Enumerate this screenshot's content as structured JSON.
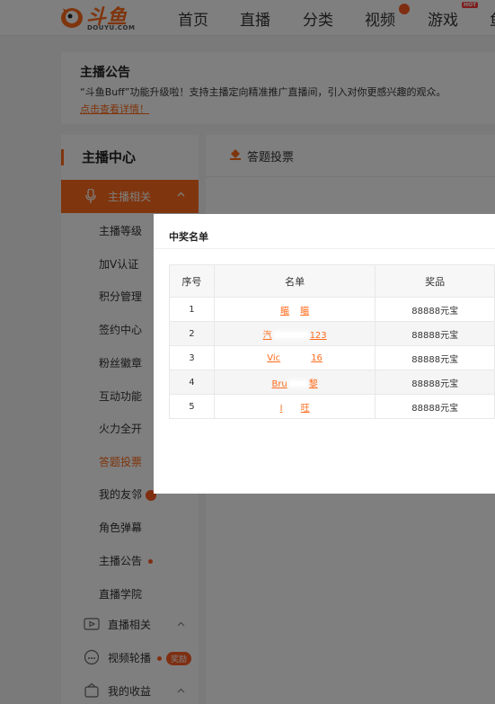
{
  "header": {
    "logo_text": "斗鱼",
    "logo_sub": "DOUYU.COM",
    "nav": [
      {
        "label": "首页"
      },
      {
        "label": "直播"
      },
      {
        "label": "分类"
      },
      {
        "label": "视频"
      },
      {
        "label": "游戏",
        "badge": "HOT"
      },
      {
        "label": "鱼"
      }
    ]
  },
  "announcement": {
    "title": "主播公告",
    "text": "“斗鱼Buff”功能升级啦！支持主播定向精准推广直播间，引入对你更感兴趣的观众。",
    "link": "点击查看详情！"
  },
  "sidebar": {
    "title": "主播中心",
    "active_group": "主播相关",
    "items": [
      {
        "label": "主播等级"
      },
      {
        "label": "加V认证"
      },
      {
        "label": "积分管理"
      },
      {
        "label": "签约中心"
      },
      {
        "label": "粉丝徽章"
      },
      {
        "label": "互动功能"
      },
      {
        "label": "火力全开"
      },
      {
        "label": "答题投票"
      },
      {
        "label": "我的友邻"
      },
      {
        "label": "角色弹幕"
      },
      {
        "label": "主播公告"
      },
      {
        "label": "直播学院"
      }
    ],
    "groups": [
      {
        "label": "直播相关"
      },
      {
        "label": "视频轮播",
        "badge": "奖励"
      },
      {
        "label": "我的收益"
      }
    ]
  },
  "main": {
    "tab": "答题投票"
  },
  "modal": {
    "title": "中奖名单",
    "columns": [
      "序号",
      "名单",
      "奖品"
    ],
    "rows": [
      {
        "index": "1",
        "name_a": "瞄",
        "name_b": "瞄",
        "prize": "88888元宝"
      },
      {
        "index": "2",
        "name_a": "汽",
        "name_b": "123",
        "prize": "88888元宝"
      },
      {
        "index": "3",
        "name_a": "Vic",
        "name_b": "16",
        "prize": "88888元宝"
      },
      {
        "index": "4",
        "name_a": "Bru",
        "name_b": "黎",
        "prize": "88888元宝"
      },
      {
        "index": "5",
        "name_a": "I",
        "name_b": "旺",
        "prize": "88888元宝"
      }
    ]
  },
  "colors": {
    "accent": "#ff6b1a",
    "overlay": "rgba(0,0,0,0.5)"
  }
}
